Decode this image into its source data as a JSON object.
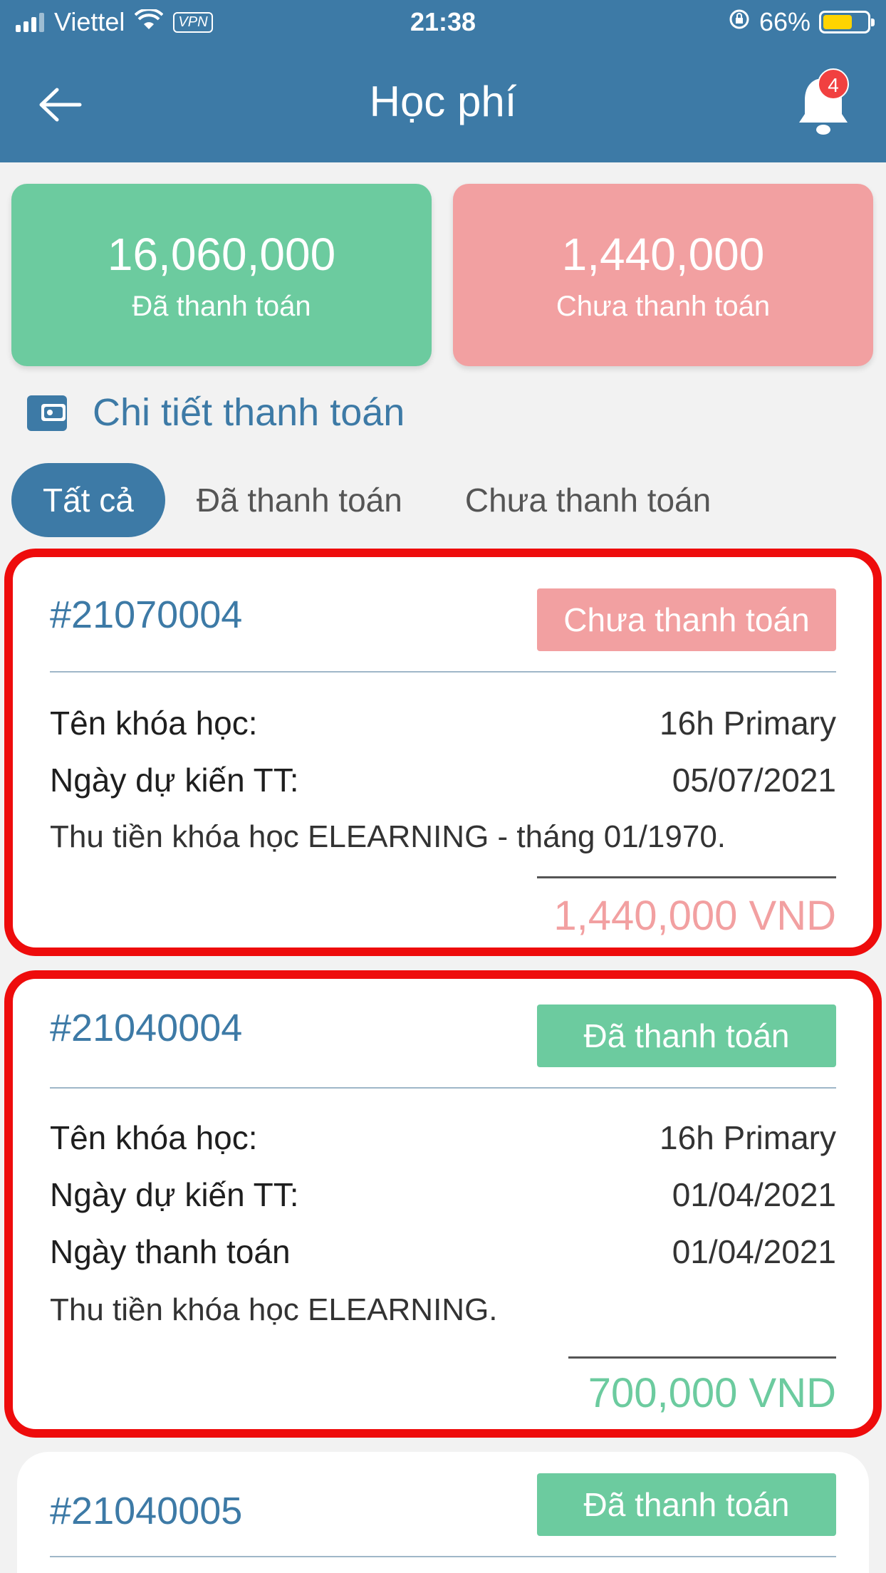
{
  "status_bar": {
    "carrier": "Viettel",
    "vpn": "VPN",
    "time": "21:38",
    "battery": "66%",
    "battery_level": 0.66
  },
  "header": {
    "title": "Học phí",
    "notification_count": "4"
  },
  "summary": {
    "paid_amount": "16,060,000",
    "paid_label": "Đã thanh toán",
    "unpaid_amount": "1,440,000",
    "unpaid_label": "Chưa thanh toán"
  },
  "section": {
    "title": "Chi tiết thanh toán"
  },
  "tabs": [
    {
      "label": "Tất cả",
      "active": true
    },
    {
      "label": "Đã thanh toán",
      "active": false
    },
    {
      "label": "Chưa thanh toán",
      "active": false
    }
  ],
  "cards": [
    {
      "id": "#21070004",
      "status": "Chưa thanh toán",
      "rows": [
        {
          "label": "Tên khóa học:",
          "value": "16h Primary"
        },
        {
          "label": "Ngày dự kiến TT:",
          "value": "05/07/2021"
        }
      ],
      "note": "Thu tiền khóa học ELEARNING - tháng 01/1970.",
      "total": "1,440,000 VND"
    },
    {
      "id": "#21040004",
      "status": "Đã thanh toán",
      "rows": [
        {
          "label": "Tên khóa học:",
          "value": "16h Primary"
        },
        {
          "label": "Ngày dự kiến TT:",
          "value": "01/04/2021"
        },
        {
          "label": "Ngày thanh toán",
          "value": "01/04/2021"
        }
      ],
      "note": "Thu tiền khóa học ELEARNING.",
      "total": "700,000 VND"
    },
    {
      "id": "#21040005",
      "status": "Đã thanh toán"
    }
  ],
  "colors": {
    "primary": "#3d7aa6",
    "paid": "#6ccb9f",
    "unpaid": "#f2a0a1",
    "highlight": "#ee0c0c"
  }
}
